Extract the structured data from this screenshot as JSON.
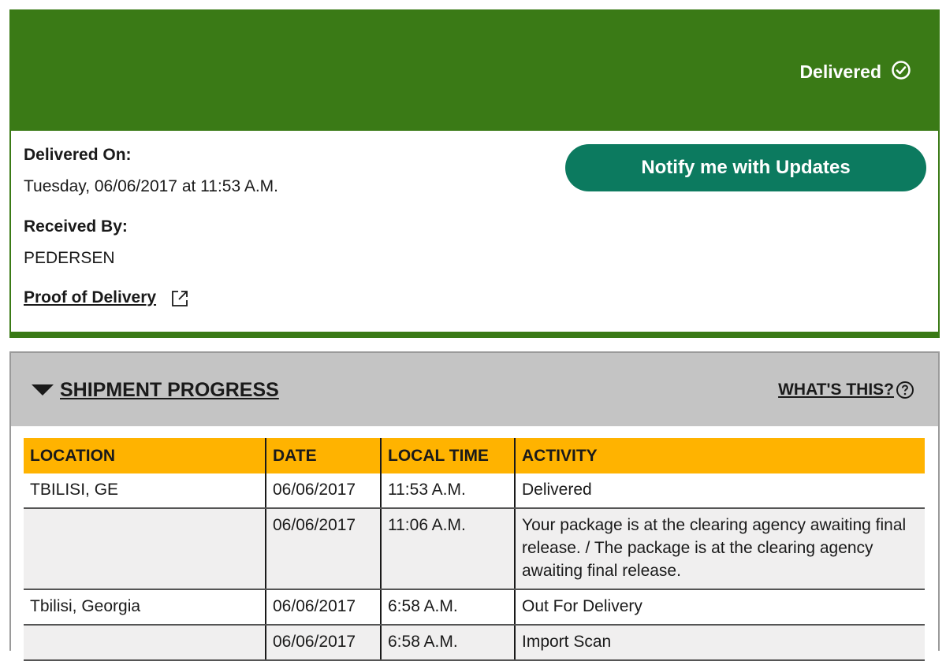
{
  "status": {
    "text": "Delivered",
    "icon": "check-circle-icon"
  },
  "delivery": {
    "delivered_on_label": "Delivered On:",
    "delivered_on_value": "Tuesday,  06/06/2017 at 11:53 A.M.",
    "received_by_label": "Received By:",
    "received_by_value": "PEDERSEN",
    "proof_link": "Proof of Delivery",
    "notify_button": "Notify me with Updates"
  },
  "progress": {
    "title": "SHIPMENT PROGRESS",
    "whats_this": "WHAT'S THIS?",
    "columns": [
      "LOCATION",
      "DATE",
      "LOCAL TIME",
      "ACTIVITY"
    ],
    "rows": [
      {
        "location": "TBILISI, GE",
        "date": "06/06/2017",
        "time": "11:53 A.M.",
        "activity": "Delivered"
      },
      {
        "location": "",
        "date": "06/06/2017",
        "time": "11:06 A.M.",
        "activity": "Your package is at the clearing agency awaiting final release. / The package is at the clearing agency awaiting final release."
      },
      {
        "location": "Tbilisi, Georgia",
        "date": "06/06/2017",
        "time": "6:58 A.M.",
        "activity": "Out For Delivery"
      },
      {
        "location": "",
        "date": "06/06/2017",
        "time": "6:58 A.M.",
        "activity": "Import Scan"
      }
    ]
  },
  "colors": {
    "banner": "#3a7a16",
    "button": "#0c7a5f",
    "table_header": "#ffb300",
    "progress_header": "#c4c4c4"
  }
}
